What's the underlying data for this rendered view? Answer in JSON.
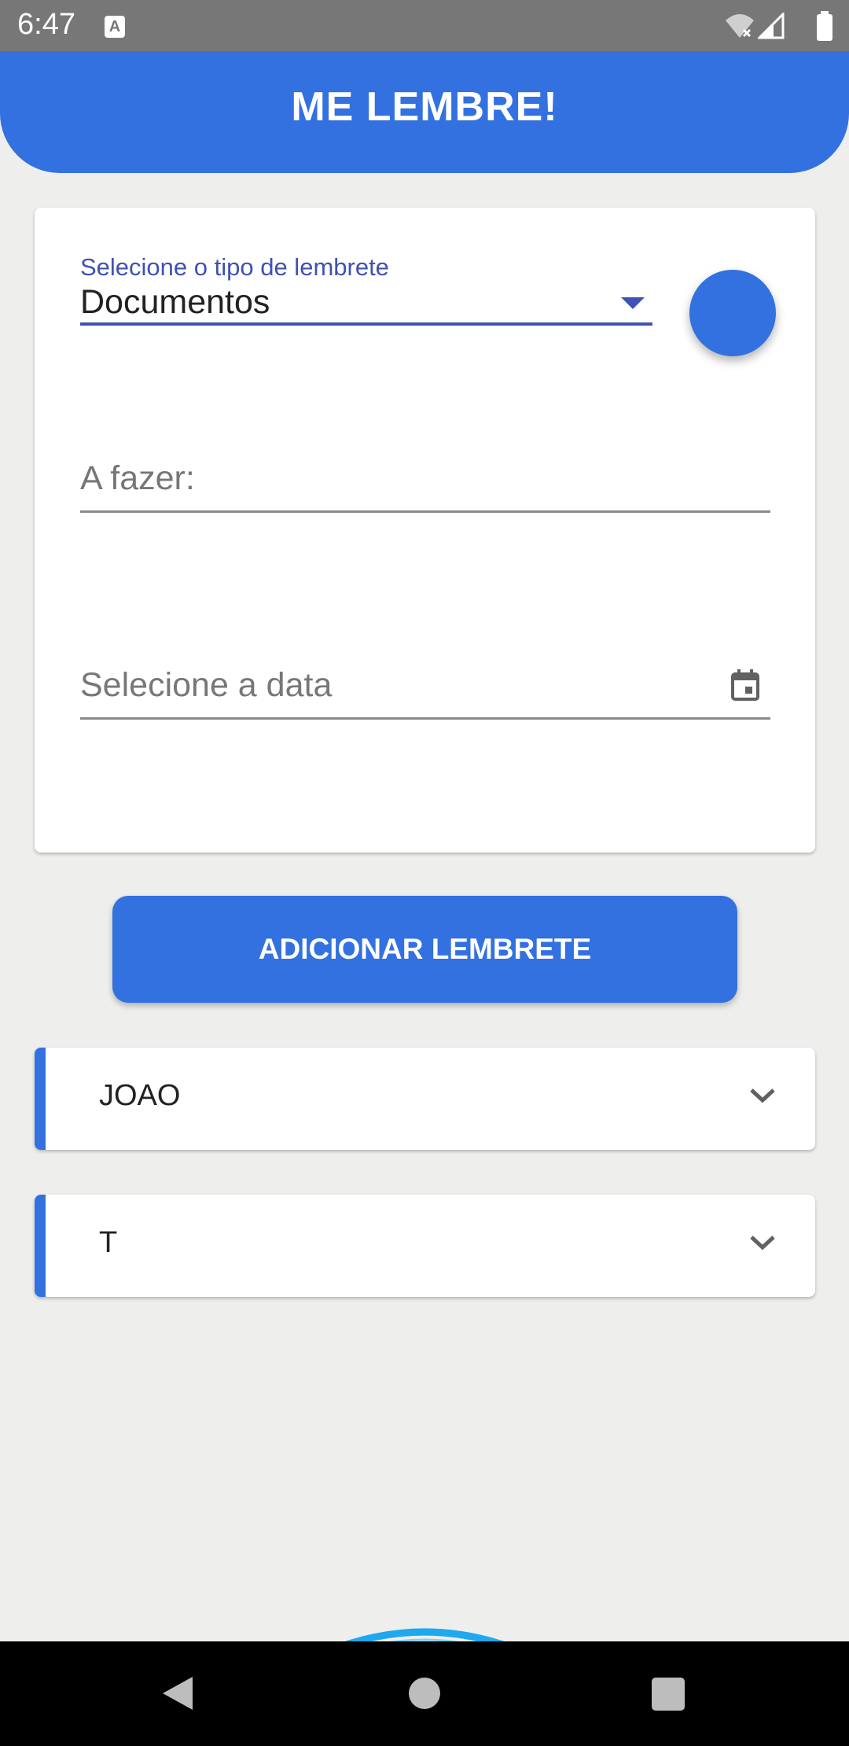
{
  "status_bar": {
    "time": "6:47",
    "notification_icon": "A",
    "icons": [
      "wifi-icon",
      "signal-icon",
      "battery-icon"
    ]
  },
  "app_bar": {
    "title": "ME LEMBRE!",
    "color": "#3271df"
  },
  "form": {
    "type_select": {
      "label": "Selecione o tipo de lembrete",
      "value": "Documentos"
    },
    "selected_color": "#3271df",
    "todo_field": {
      "placeholder": "A fazer:"
    },
    "date_field": {
      "placeholder": "Selecione a data",
      "icon": "calendar-icon"
    }
  },
  "add_button": {
    "label": "ADICIONAR LEMBRETE"
  },
  "reminders": [
    {
      "label": "JOAO"
    },
    {
      "label": "T"
    }
  ],
  "nav_bar": {
    "icons": [
      "back-icon",
      "home-icon",
      "recents-icon"
    ]
  }
}
